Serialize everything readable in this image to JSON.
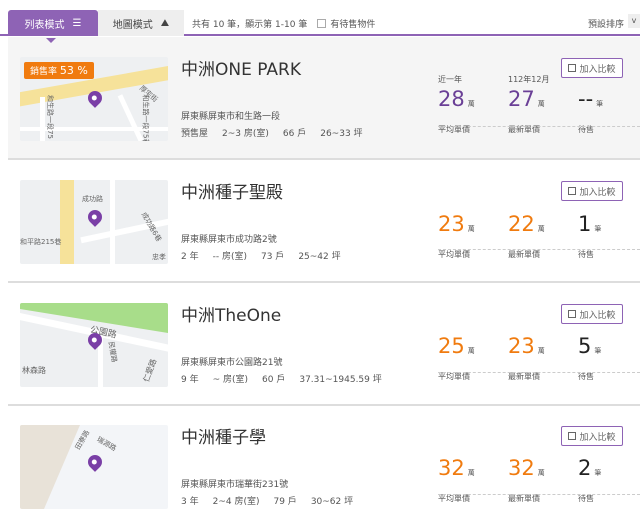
{
  "toolbar": {
    "list_tab": "列表模式",
    "map_tab": "地圖模式",
    "count_text": "共有 10 筆，顯示第 1-10 筆",
    "for_sale_label": "有待售物件",
    "sort_label": "預設排序",
    "sort_arrow": "v"
  },
  "common": {
    "compare": "加入比較",
    "avg_label": "平均單價",
    "latest_label": "最新單價",
    "sale_label": "待售",
    "wan": "萬",
    "unit": "筆"
  },
  "listings": [
    {
      "title": "中洲ONE PARK",
      "badge_label": "銷售率",
      "badge_value": "53 %",
      "address": "屏東縣屏東市和生路一段",
      "age": "預售屋",
      "rooms": "2~3 房(室)",
      "units": "66 戶",
      "area": "26~33 坪",
      "period_avg": "近一年",
      "period_latest": "112年12月",
      "avg": "28",
      "latest": "27",
      "sale": "--",
      "map_labels": [
        "和生路一段75",
        "厚宅街",
        "和生路一段75巷"
      ]
    },
    {
      "title": "中洲種子聖殿",
      "address": "屏東縣屏東市成功路2號",
      "age": "2 年",
      "rooms": "-- 房(室)",
      "units": "73 戶",
      "area": "25~42 坪",
      "avg": "23",
      "latest": "22",
      "sale": "1",
      "map_labels": [
        "成功路",
        "和平路215巷",
        "成功路6巷",
        "忠孝"
      ]
    },
    {
      "title": "中洲TheOne",
      "address": "屏東縣屏東市公園路21號",
      "age": "9 年",
      "rooms": "~ 房(室)",
      "units": "60 戶",
      "area": "37.31~1945.59 坪",
      "avg": "25",
      "latest": "23",
      "sale": "5",
      "map_labels": [
        "公園路",
        "林森路",
        "仁愛路",
        "民權路"
      ]
    },
    {
      "title": "中洲種子學",
      "address": "屏東縣屏東市瑞華街231號",
      "age": "3 年",
      "rooms": "2~4 房(室)",
      "units": "79 戶",
      "area": "30~62 坪",
      "avg": "32",
      "latest": "32",
      "sale": "2",
      "map_labels": [
        "田寮路",
        "瑞源路"
      ]
    }
  ]
}
